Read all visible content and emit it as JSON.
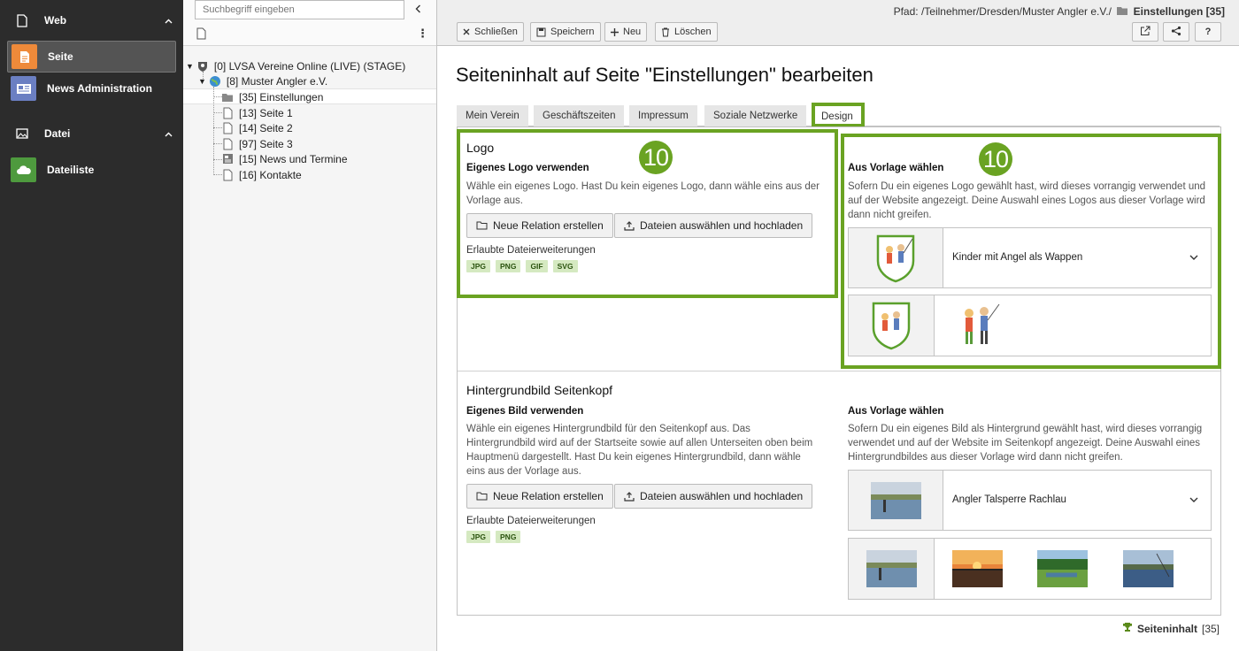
{
  "module_menu": {
    "groups": [
      {
        "label": "Web",
        "items": [
          {
            "label": "Seite"
          },
          {
            "label": "News Administration"
          }
        ]
      },
      {
        "label": "Datei",
        "items": [
          {
            "label": "Dateiliste"
          }
        ]
      }
    ]
  },
  "page_tree": {
    "search_placeholder": "Suchbegriff eingeben",
    "nodes": [
      {
        "label": "[0] LVSA Vereine Online (LIVE) (STAGE)"
      },
      {
        "label": "[8] Muster Angler e.V."
      },
      {
        "label": "[35] Einstellungen"
      },
      {
        "label": "[13] Seite 1"
      },
      {
        "label": "[14] Seite 2"
      },
      {
        "label": "[97] Seite 3"
      },
      {
        "label": "[15] News und Termine"
      },
      {
        "label": "[16] Kontakte"
      }
    ]
  },
  "doc_header": {
    "path_prefix": "Pfad: /Teilnehmer/Dresden/Muster Angler e.V./",
    "path_current": "Einstellungen [35]",
    "buttons": {
      "close": "Schließen",
      "save": "Speichern",
      "new": "Neu",
      "delete": "Löschen"
    }
  },
  "page_title": "Seiteninhalt auf Seite \"Einstellungen\" bearbeiten",
  "tabs": [
    "Mein Verein",
    "Geschäftszeiten",
    "Impressum",
    "Soziale Netzwerke",
    "Design"
  ],
  "annotation_badge": "10",
  "logo_section": {
    "title": "Logo",
    "own": {
      "label": "Eigenes Logo verwenden",
      "desc": "Wähle ein eigenes Logo. Hast Du kein eigenes Logo, dann wähle eins aus der Vorlage aus.",
      "btn_relation": "Neue Relation erstellen",
      "btn_upload": "Dateien auswählen und hochladen",
      "ext_label": "Erlaubte Dateierweiterungen",
      "exts": [
        "JPG",
        "PNG",
        "GIF",
        "SVG"
      ]
    },
    "template": {
      "label": "Aus Vorlage wählen",
      "desc": "Sofern Du ein eigenes Logo gewählt hast, wird dieses vorrangig verwendet und auf der Website angezeigt. Deine Auswahl eines Logos aus dieser Vorlage wird dann nicht greifen.",
      "selected": "Kinder mit Angel als Wappen"
    }
  },
  "header_section": {
    "title": "Hintergrundbild Seitenkopf",
    "own": {
      "label": "Eigenes Bild verwenden",
      "desc": "Wähle ein eigenes Hintergrundbild für den Seitenkopf aus. Das Hintergrundbild wird auf der Startseite sowie auf allen Unterseiten oben beim Hauptmenü dargestellt. Hast Du kein eigenes Hintergrundbild, dann wähle eins aus der Vorlage aus.",
      "btn_relation": "Neue Relation erstellen",
      "btn_upload": "Dateien auswählen und hochladen",
      "ext_label": "Erlaubte Dateierweiterungen",
      "exts": [
        "JPG",
        "PNG"
      ]
    },
    "template": {
      "label": "Aus Vorlage wählen",
      "desc": "Sofern Du ein eigenes Bild als Hintergrund gewählt hast, wird dieses vorrangig verwendet und auf der Website im Seitenkopf angezeigt. Deine Auswahl eines Hintergrundbildes aus dieser Vorlage wird dann nicht greifen.",
      "selected": "Angler Talsperre Rachlau"
    }
  },
  "footer": {
    "label": "Seiteninhalt",
    "id": "[35]"
  },
  "colors": {
    "highlight": "#6aa322",
    "sidebar": "#2c2c2c",
    "seite_icon": "#ee8a3a",
    "news_icon": "#6b7fc2",
    "file_icon": "#4e9a3e"
  }
}
